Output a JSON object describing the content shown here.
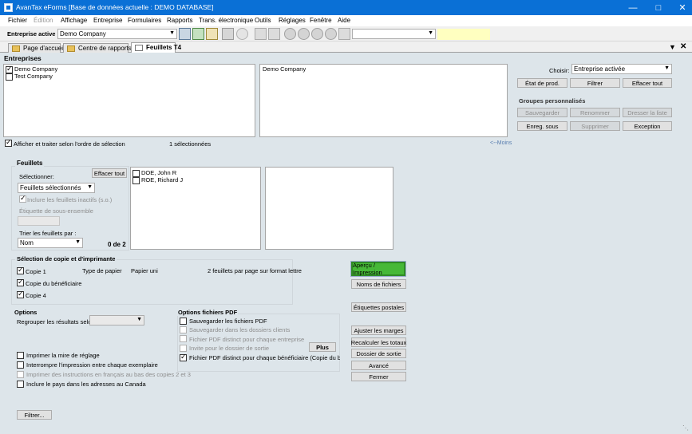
{
  "window": {
    "title": "AvanTax eForms  [Base de données actuelle : DEMO DATABASE]"
  },
  "menu": [
    "Fichier",
    "Édition",
    "Affichage",
    "Entreprise",
    "Formulaires",
    "Rapports",
    "Trans. électronique",
    "Outils",
    "Réglages",
    "Fenêtre",
    "Aide"
  ],
  "toolbar": {
    "company_label": "Entreprise active :",
    "company_value": "Demo Company"
  },
  "tabs": [
    "Page d'accueil",
    "Centre de rapports",
    "Feuillets T4"
  ],
  "entreprises": {
    "heading": "Entreprises",
    "list": [
      "Demo Company",
      "Test Company"
    ],
    "selected_list": [
      "Demo Company"
    ],
    "order_label": "Afficher et traiter selon l'ordre de sélection",
    "selected_count": "1 sélectionnées",
    "less_link": "<--Moins"
  },
  "right_panel": {
    "choose_label": "Choisir:",
    "choose_value": "Entreprise activée",
    "btn_prod": "État de prod.",
    "btn_filter": "Filtrer",
    "btn_clear_all": "Effacer tout",
    "groups_heading": "Groupes personnalisés",
    "btn_save": "Sauvegarder",
    "btn_rename": "Renommer",
    "btn_make_list": "Dresser la liste",
    "btn_save_as": "Enreg. sous",
    "btn_delete": "Supprimer",
    "btn_exception": "Exception"
  },
  "feuillets": {
    "heading": "Feuillets",
    "select_label": "Sélectionner:",
    "btn_clear": "Effacer tout",
    "select_value": "Feuillets sélectionnés",
    "include_inactive": "Inclure les feuillets inactifs (s.o.)",
    "subset_label": "Étiquette de sous-ensemble",
    "sort_label": "Trier les feuillets par :",
    "sort_value": "Nom",
    "count": "0 de 2",
    "list": [
      "DOE, John R",
      "ROE, Richard J"
    ]
  },
  "copies": {
    "heading": "Sélection de copie et d'imprimante",
    "paper_type_label": "Type de papier",
    "paper_value": "Papier uni",
    "per_page": "2 feuillets par page sur format lettre",
    "items": [
      "Copie 1",
      "Copie du bénéficiaire",
      "Copie 4"
    ]
  },
  "actions": {
    "preview": "Aperçu / Impression",
    "filenames": "Noms de fichiers",
    "mail_labels": "Étiquettes postales",
    "adjust_margins": "Ajuster les marges",
    "recalc": "Recalculer les totaux",
    "output_folder": "Dossier de sortie",
    "advanced": "Avancé",
    "close": "Fermer"
  },
  "options": {
    "heading": "Options",
    "group_label": "Regrouper les résultats selon",
    "items": [
      "Imprimer la mire de réglage",
      "Interrompre l'impression entre chaque exemplaire",
      "Imprimer des instructions en français au bas des copies 2 et 3",
      "Inclure le pays dans les adresses au Canada"
    ],
    "btn_filter": "Filtrer..."
  },
  "pdf": {
    "heading": "Options fichiers PDF",
    "items": [
      "Sauvegarder les fichiers PDF",
      "Sauvegarder dans les dossiers clients",
      "Fichier PDF distinct pour chaque entreprise",
      "Invite pour le dossier de sortie",
      "Fichier PDF distinct pour chaque bénéficiaire (Copie du bénéficiaire"
    ],
    "btn_more": "Plus"
  }
}
